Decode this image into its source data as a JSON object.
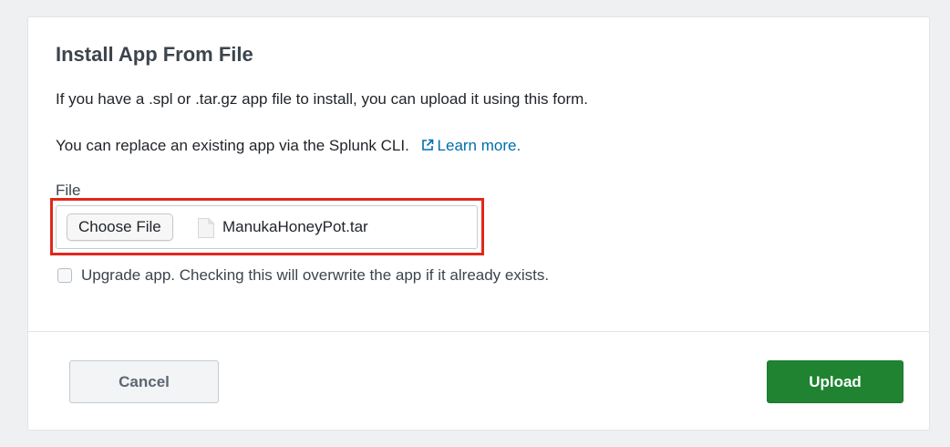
{
  "dialog": {
    "title": "Install App From File",
    "intro_text": "If you have a .spl or .tar.gz app file to install, you can upload it using this form.",
    "cli_text": "You can replace an existing app via the Splunk CLI.",
    "learn_more_label": "Learn more.",
    "learn_more_icon": "external-link-icon",
    "file_field": {
      "label": "File",
      "choose_button_label": "Choose File",
      "file_icon": "file-document-icon",
      "selected_file_name": "ManukaHoneyPot.tar"
    },
    "upgrade_checkbox": {
      "label": "Upgrade app. Checking this will overwrite the app if it already exists.",
      "checked": false
    },
    "footer": {
      "cancel_label": "Cancel",
      "upload_label": "Upload"
    }
  },
  "colors": {
    "link": "#006eaa",
    "primary_button": "#1f8331",
    "highlight_annotation": "#e0281b"
  }
}
